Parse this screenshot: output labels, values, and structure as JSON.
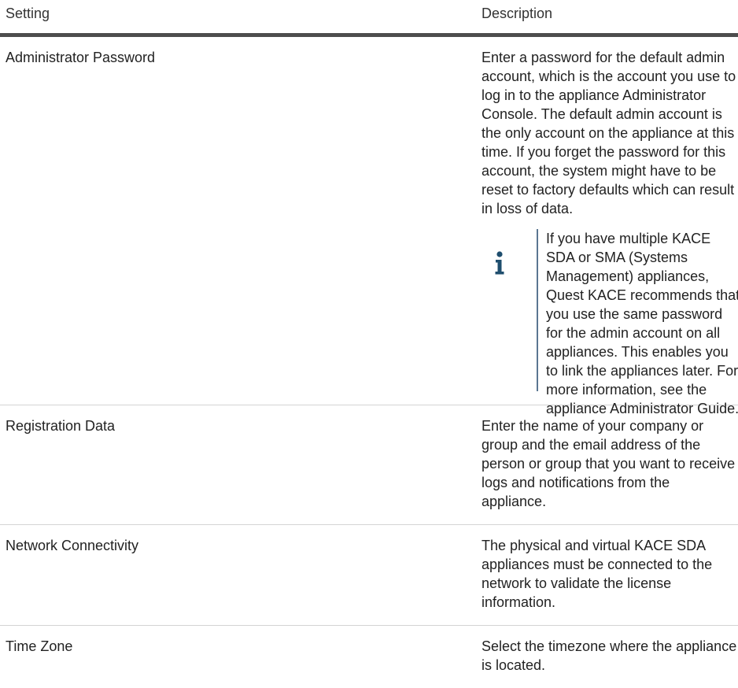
{
  "header": {
    "setting": "Setting",
    "description": "Description"
  },
  "rows": [
    {
      "setting": "Administrator Password",
      "description": "Enter a password for the default admin account, which is the account you use to log in to the appliance Administrator Console. The default admin account is the only account on the appliance at this time. If you forget the password for this account, the system might have to be reset to factory defaults which can result in loss of data.",
      "note": "If you have multiple KACE SDA or SMA (Systems Management) appliances, Quest KACE recommends that you use the same password for the admin account on all appliances. This enables you to link the appliances later. For more information, see the appliance Administrator Guide."
    },
    {
      "setting": "Registration Data",
      "description": "Enter the name of your company or group and the email address of the person or group that you want to receive logs and notifications from the appliance."
    },
    {
      "setting": "Network Connectivity",
      "description": "The physical and virtual KACE SDA appliances must be connected to the network to validate the license information."
    },
    {
      "setting": "Time Zone",
      "description": "Select the timezone where the appliance is located."
    }
  ],
  "colors": {
    "header_rule": "#4d4d4d",
    "row_rule": "#d4d4d4",
    "note_bar": "#5a7691",
    "info_icon": "#1f4e6e"
  },
  "icons": {
    "note": "info-icon"
  }
}
